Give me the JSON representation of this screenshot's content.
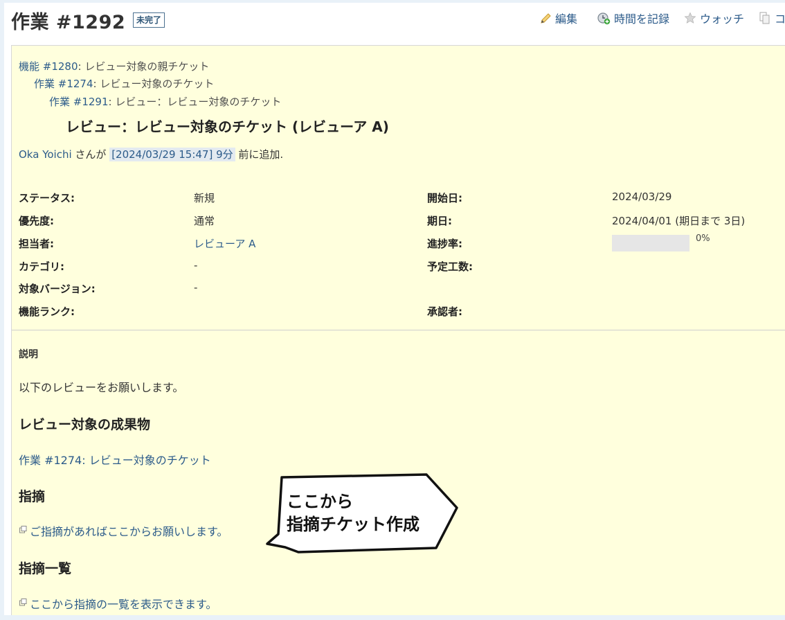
{
  "header": {
    "title": "作業 #1292",
    "status_badge": "未完了",
    "actions": {
      "edit": "編集",
      "log_time": "時間を記録",
      "watch": "ウォッチ",
      "copy": "コ"
    }
  },
  "ancestors": [
    {
      "link": "機能 #1280",
      "text": ": レビュー対象の親チケット"
    },
    {
      "link": "作業 #1274",
      "text": ": レビュー対象のチケット"
    },
    {
      "link": "作業 #1291",
      "text": ": レビュー：レビュー対象のチケット"
    }
  ],
  "subject": "レビュー：レビュー対象のチケット (レビューア A)",
  "author_line": {
    "author": "Oka Yoichi",
    "mid": " さんが ",
    "timestamp": "[2024/03/29 15:47] 9分",
    "suffix": " 前に追加."
  },
  "attributes": {
    "left": [
      {
        "label": "ステータス:",
        "value": "新規"
      },
      {
        "label": "優先度:",
        "value": "通常"
      },
      {
        "label": "担当者:",
        "value": "レビューア A"
      },
      {
        "label": "カテゴリ:",
        "value": "-"
      },
      {
        "label": "対象バージョン:",
        "value": "-"
      },
      {
        "label": "機能ランク:",
        "value": ""
      }
    ],
    "right": [
      {
        "label": "開始日:",
        "value": "2024/03/29"
      },
      {
        "label": "期日:",
        "value": "2024/04/01 (期日まで 3日)"
      },
      {
        "label": "進捗率:",
        "value": "0%"
      },
      {
        "label": "予定工数:",
        "value": ""
      },
      {
        "label": "承認者:",
        "value": ""
      }
    ],
    "progress_fraction": 0
  },
  "description": {
    "heading": "説明",
    "intro": "以下のレビューをお願いします。",
    "section1_title": "レビュー対象の成果物",
    "section1_link": "作業 #1274: レビュー対象のチケット",
    "section2_title": "指摘",
    "section2_link": "ご指摘があればここからお願いします。",
    "section3_title": "指摘一覧",
    "section3_link": "ここから指摘の一覧を表示できます。"
  },
  "callout": {
    "line1": "ここから",
    "line2": "指摘チケット作成"
  },
  "colors": {
    "issue_bg": "#ffffdd",
    "link": "#2c5b8a",
    "page_bg": "#e9f1f8"
  }
}
